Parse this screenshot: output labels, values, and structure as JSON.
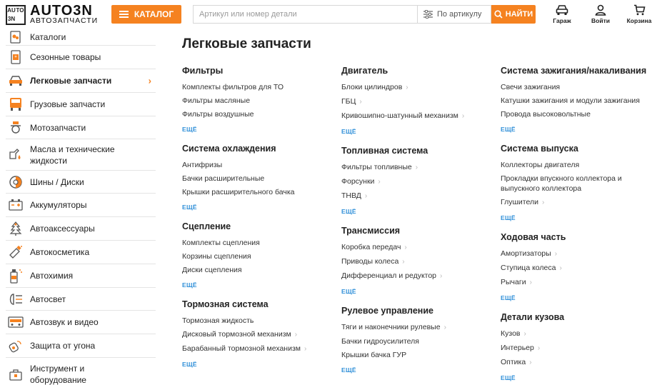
{
  "header": {
    "logo_main": "AUTO3N",
    "logo_sub": "АВТОЗАПЧАСТИ",
    "logo_box": [
      "AU",
      "TO",
      "3N",
      ""
    ],
    "catalog_label": "КАТАЛОГ",
    "search_placeholder": "Артикул или номер детали",
    "search_mode": "По артикулу",
    "search_button": "НАЙТИ",
    "garage": "Гараж",
    "login": "Войти",
    "cart": "Корзина"
  },
  "colors": {
    "accent": "#f58220",
    "link": "#2f8fd8"
  },
  "sidebar": [
    {
      "label": "Каталоги",
      "icon": "catalog-icon"
    },
    {
      "label": "Сезонные товары",
      "icon": "seasonal-icon"
    },
    {
      "label": "Легковые запчасти",
      "icon": "car-icon",
      "active": true
    },
    {
      "label": "Грузовые запчасти",
      "icon": "truck-icon"
    },
    {
      "label": "Мотозапчасти",
      "icon": "moto-icon"
    },
    {
      "label": "Масла и технические жидкости",
      "icon": "oil-icon"
    },
    {
      "label": "Шины / Диски",
      "icon": "tire-icon"
    },
    {
      "label": "Аккумуляторы",
      "icon": "battery-icon"
    },
    {
      "label": "Автоаксессуары",
      "icon": "tree-icon"
    },
    {
      "label": "Автокосметика",
      "icon": "spray-icon"
    },
    {
      "label": "Автохимия",
      "icon": "chemistry-icon"
    },
    {
      "label": "Автосвет",
      "icon": "headlight-icon"
    },
    {
      "label": "Автозвук и видео",
      "icon": "audio-icon"
    },
    {
      "label": "Защита от угона",
      "icon": "key-icon"
    },
    {
      "label": "Инструмент и оборудование",
      "icon": "tools-icon"
    }
  ],
  "main": {
    "title": "Легковые запчасти",
    "more_label": "ЕЩЁ",
    "columns": [
      [
        {
          "title": "Фильтры",
          "items": [
            {
              "label": "Комплекты фильтров для ТО",
              "chevron": false
            },
            {
              "label": "Фильтры масляные",
              "chevron": false
            },
            {
              "label": "Фильтры воздушные",
              "chevron": false
            }
          ]
        },
        {
          "title": "Система охлаждения",
          "items": [
            {
              "label": "Антифризы",
              "chevron": false
            },
            {
              "label": "Бачки расширительные",
              "chevron": false
            },
            {
              "label": "Крышки расширительного бачка",
              "chevron": false
            }
          ]
        },
        {
          "title": "Сцепление",
          "items": [
            {
              "label": "Комплекты сцепления",
              "chevron": false
            },
            {
              "label": "Корзины сцепления",
              "chevron": false
            },
            {
              "label": "Диски сцепления",
              "chevron": false
            }
          ]
        },
        {
          "title": "Тормозная система",
          "items": [
            {
              "label": "Тормозная жидкость",
              "chevron": false
            },
            {
              "label": "Дисковый тормозной механизм",
              "chevron": true
            },
            {
              "label": "Барабанный тормозной механизм",
              "chevron": true
            }
          ]
        }
      ],
      [
        {
          "title": "Двигатель",
          "items": [
            {
              "label": "Блоки цилиндров",
              "chevron": true
            },
            {
              "label": "ГБЦ",
              "chevron": true
            },
            {
              "label": "Кривошипно-шатунный механизм",
              "chevron": true
            }
          ]
        },
        {
          "title": "Топливная система",
          "items": [
            {
              "label": "Фильтры топливные",
              "chevron": true
            },
            {
              "label": "Форсунки",
              "chevron": true
            },
            {
              "label": "ТНВД",
              "chevron": true
            }
          ]
        },
        {
          "title": "Трансмиссия",
          "items": [
            {
              "label": "Коробка передач",
              "chevron": true
            },
            {
              "label": "Приводы колеса",
              "chevron": true
            },
            {
              "label": "Дифференциал и редуктор",
              "chevron": true
            }
          ]
        },
        {
          "title": "Рулевое управление",
          "items": [
            {
              "label": "Тяги и наконечники рулевые",
              "chevron": true
            },
            {
              "label": "Бачки гидроусилителя",
              "chevron": false
            },
            {
              "label": "Крышки бачка ГУР",
              "chevron": false
            }
          ]
        }
      ],
      [
        {
          "title": "Система зажигания/накаливания",
          "items": [
            {
              "label": "Свечи зажигания",
              "chevron": false
            },
            {
              "label": "Катушки зажигания и модули зажигания",
              "chevron": false
            },
            {
              "label": "Провода высоковольтные",
              "chevron": false
            }
          ]
        },
        {
          "title": "Система выпуска",
          "items": [
            {
              "label": "Коллекторы двигателя",
              "chevron": false
            },
            {
              "label": "Прокладки впускного коллектора и выпускного коллектора",
              "chevron": false
            },
            {
              "label": "Глушители",
              "chevron": true
            }
          ]
        },
        {
          "title": "Ходовая часть",
          "items": [
            {
              "label": "Амортизаторы",
              "chevron": true
            },
            {
              "label": "Ступица колеса",
              "chevron": true
            },
            {
              "label": "Рычаги",
              "chevron": true
            }
          ]
        },
        {
          "title": "Детали кузова",
          "items": [
            {
              "label": "Кузов",
              "chevron": true
            },
            {
              "label": "Интерьер",
              "chevron": true
            },
            {
              "label": "Оптика",
              "chevron": true
            }
          ]
        }
      ]
    ]
  }
}
